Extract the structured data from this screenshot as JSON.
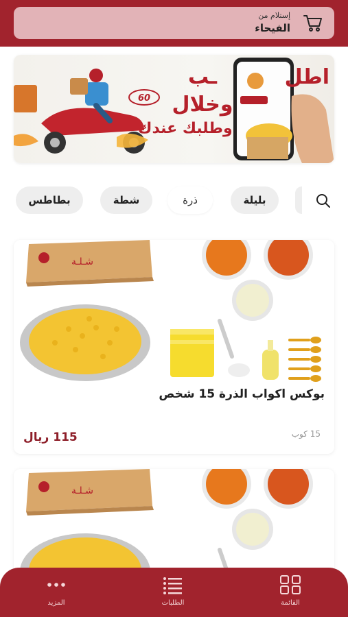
{
  "header": {
    "pickup_label": "إستلام من",
    "location": "الفيحاء",
    "cart_icon": "cart-icon"
  },
  "banner": {
    "line1": "اطلب",
    "line2": "وخلال",
    "line3": "وطلبك عندك",
    "badge": "60 min"
  },
  "categories": [
    {
      "label": "بطاطس",
      "active": false
    },
    {
      "label": "شطة",
      "active": false
    },
    {
      "label": "ذرة",
      "active": true
    },
    {
      "label": "بليلة",
      "active": false
    }
  ],
  "products": [
    {
      "title": "بوكس اكواب الذرة 15 شخص",
      "price": "115 ريال",
      "qty": "15 كوب"
    },
    {
      "title": "",
      "price": "",
      "qty": ""
    }
  ],
  "nav": {
    "home": "القائمة",
    "orders": "الطلبات",
    "more": "المزيد"
  },
  "colors": {
    "brand": "#a1232d",
    "pickup_bg": "#e2b3b7",
    "price": "#8e1f2a"
  }
}
